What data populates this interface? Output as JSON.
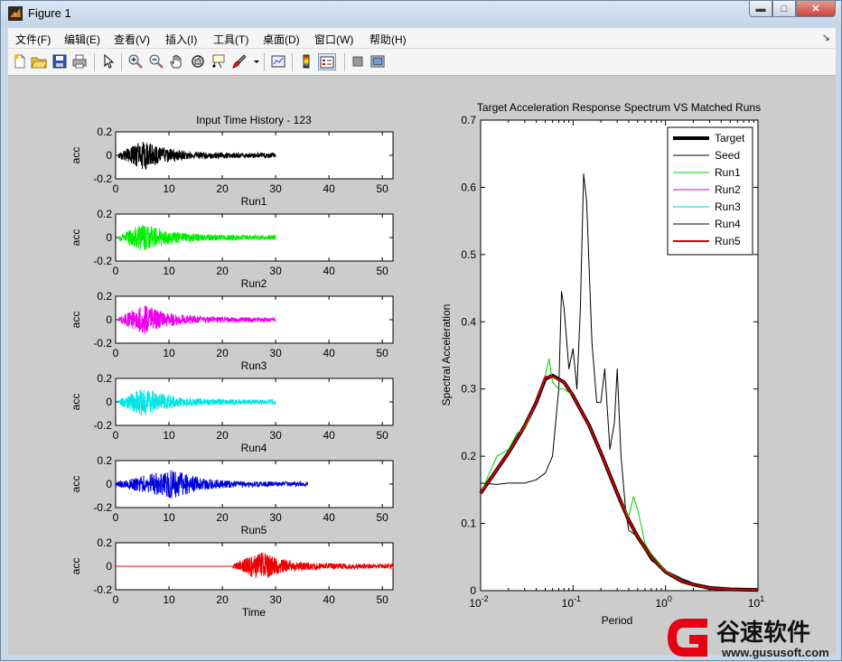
{
  "window": {
    "title": "Figure 1",
    "min": "▬",
    "max": "□",
    "close": "✕"
  },
  "menu": [
    "文件(F)",
    "编辑(E)",
    "查看(V)",
    "插入(I)",
    "工具(T)",
    "桌面(D)",
    "窗口(W)",
    "帮助(H)"
  ],
  "menu_overflow": "↘",
  "toolbar": [
    "new-file-icon",
    "open-folder-icon",
    "save-icon",
    "print-icon",
    "arrow-pointer-icon",
    "zoom-in-icon",
    "zoom-out-icon",
    "pan-hand-icon",
    "rotate-3d-icon",
    "data-cursor-icon",
    "brush-icon",
    "brush-dropdown-icon",
    "link-plot-icon",
    "colorbar-icon",
    "legend-icon",
    "hide-plot-tools-icon",
    "show-plot-tools-icon"
  ],
  "left_panel": {
    "title": "Input Time History - 123",
    "ylabel": "acc",
    "yticks": [
      "0.2",
      "0",
      "-0.2"
    ],
    "xticks": [
      "0",
      "10",
      "20",
      "30",
      "40",
      "50"
    ],
    "subplots": [
      {
        "caption": "Run1",
        "color": "#000000"
      },
      {
        "caption": "Run2",
        "color": "#00ee00"
      },
      {
        "caption": "Run3",
        "color": "#ee00ee"
      },
      {
        "caption": "Run4",
        "color": "#00e6e6"
      },
      {
        "caption": "Run5",
        "color": "#0000dd"
      },
      {
        "caption": "Time",
        "color": "#ee0000"
      }
    ]
  },
  "chart_data": {
    "type": "line",
    "title": "Target Acceleration Response Spectrum VS Matched Runs",
    "xlabel": "Period",
    "ylabel": "Spectral Acceleration",
    "xscale": "log",
    "xlim": [
      0.01,
      10
    ],
    "ylim": [
      0,
      0.7
    ],
    "xticks": [
      {
        "base": "10",
        "exp": "-2"
      },
      {
        "base": "10",
        "exp": "-1"
      },
      {
        "base": "10",
        "exp": "0"
      },
      {
        "base": "10",
        "exp": "1"
      }
    ],
    "yticks": [
      "0",
      "0.1",
      "0.2",
      "0.3",
      "0.4",
      "0.5",
      "0.6",
      "0.7"
    ],
    "legend_position": "top-right",
    "series": [
      {
        "name": "Target",
        "color": "#000000",
        "x": [
          0.01,
          0.015,
          0.02,
          0.03,
          0.04,
          0.05,
          0.06,
          0.08,
          0.1,
          0.15,
          0.2,
          0.3,
          0.4,
          0.5,
          0.7,
          1,
          1.5,
          2,
          3,
          5,
          10
        ],
        "y": [
          0.145,
          0.18,
          0.205,
          0.245,
          0.28,
          0.315,
          0.32,
          0.31,
          0.29,
          0.245,
          0.205,
          0.145,
          0.105,
          0.08,
          0.05,
          0.028,
          0.014,
          0.009,
          0.004,
          0.002,
          0.001
        ]
      },
      {
        "name": "Seed",
        "color": "#000000",
        "x": [
          0.01,
          0.015,
          0.02,
          0.03,
          0.04,
          0.05,
          0.06,
          0.07,
          0.075,
          0.08,
          0.09,
          0.1,
          0.11,
          0.12,
          0.13,
          0.14,
          0.16,
          0.18,
          0.2,
          0.22,
          0.25,
          0.28,
          0.3,
          0.33,
          0.37,
          0.4,
          0.5,
          0.6,
          0.7,
          1,
          1.5,
          2,
          3,
          5,
          10
        ],
        "y": [
          0.16,
          0.158,
          0.16,
          0.16,
          0.165,
          0.175,
          0.2,
          0.3,
          0.445,
          0.42,
          0.33,
          0.36,
          0.3,
          0.42,
          0.62,
          0.58,
          0.37,
          0.28,
          0.28,
          0.33,
          0.21,
          0.25,
          0.33,
          0.2,
          0.12,
          0.09,
          0.08,
          0.06,
          0.045,
          0.03,
          0.018,
          0.011,
          0.006,
          0.003,
          0.001
        ]
      },
      {
        "name": "Run1",
        "color": "#00cc00",
        "x": [
          0.01,
          0.015,
          0.02,
          0.025,
          0.03,
          0.04,
          0.05,
          0.055,
          0.06,
          0.07,
          0.08,
          0.1,
          0.15,
          0.2,
          0.3,
          0.4,
          0.45,
          0.5,
          0.55,
          0.6,
          0.7,
          1,
          1.5,
          2,
          3,
          5,
          10
        ],
        "y": [
          0.145,
          0.2,
          0.21,
          0.235,
          0.24,
          0.28,
          0.32,
          0.345,
          0.31,
          0.3,
          0.3,
          0.29,
          0.245,
          0.205,
          0.145,
          0.11,
          0.14,
          0.12,
          0.095,
          0.07,
          0.055,
          0.03,
          0.015,
          0.009,
          0.004,
          0.002,
          0.001
        ]
      },
      {
        "name": "Run2",
        "color": "#cc00cc",
        "x": [
          0.01,
          0.015,
          0.02,
          0.03,
          0.04,
          0.05,
          0.06,
          0.08,
          0.1,
          0.15,
          0.2,
          0.3,
          0.4,
          0.5,
          0.7,
          1,
          1.5,
          2,
          3,
          5,
          10
        ],
        "y": [
          0.145,
          0.18,
          0.205,
          0.245,
          0.28,
          0.315,
          0.32,
          0.31,
          0.29,
          0.245,
          0.205,
          0.145,
          0.105,
          0.08,
          0.05,
          0.028,
          0.014,
          0.009,
          0.004,
          0.002,
          0.001
        ]
      },
      {
        "name": "Run3",
        "color": "#00cccc",
        "x": [
          0.01,
          0.015,
          0.02,
          0.03,
          0.04,
          0.05,
          0.06,
          0.08,
          0.1,
          0.15,
          0.2,
          0.3,
          0.4,
          0.5,
          0.7,
          1,
          1.5,
          2,
          3,
          5,
          10
        ],
        "y": [
          0.145,
          0.18,
          0.205,
          0.245,
          0.28,
          0.315,
          0.32,
          0.31,
          0.29,
          0.245,
          0.205,
          0.145,
          0.105,
          0.08,
          0.05,
          0.028,
          0.014,
          0.009,
          0.004,
          0.002,
          0.001
        ]
      },
      {
        "name": "Run4",
        "color": "#000000",
        "x": [
          0.01,
          0.015,
          0.02,
          0.03,
          0.04,
          0.05,
          0.06,
          0.08,
          0.1,
          0.15,
          0.2,
          0.3,
          0.4,
          0.5,
          0.7,
          1,
          1.5,
          2,
          3,
          5,
          10
        ],
        "y": [
          0.145,
          0.18,
          0.205,
          0.245,
          0.28,
          0.315,
          0.32,
          0.31,
          0.29,
          0.245,
          0.205,
          0.145,
          0.105,
          0.08,
          0.05,
          0.028,
          0.014,
          0.009,
          0.004,
          0.002,
          0.001
        ]
      },
      {
        "name": "Run5",
        "color": "#dd0000",
        "x": [
          0.01,
          0.015,
          0.02,
          0.03,
          0.04,
          0.05,
          0.06,
          0.08,
          0.1,
          0.15,
          0.2,
          0.3,
          0.4,
          0.5,
          0.7,
          1,
          1.5,
          2,
          3,
          5,
          10
        ],
        "y": [
          0.145,
          0.18,
          0.205,
          0.245,
          0.28,
          0.318,
          0.318,
          0.31,
          0.29,
          0.245,
          0.205,
          0.145,
          0.105,
          0.08,
          0.05,
          0.028,
          0.014,
          0.009,
          0.004,
          0.002,
          0.001
        ]
      }
    ]
  },
  "watermark": {
    "brand": "谷速软件",
    "url": "www.gususoft.com"
  }
}
